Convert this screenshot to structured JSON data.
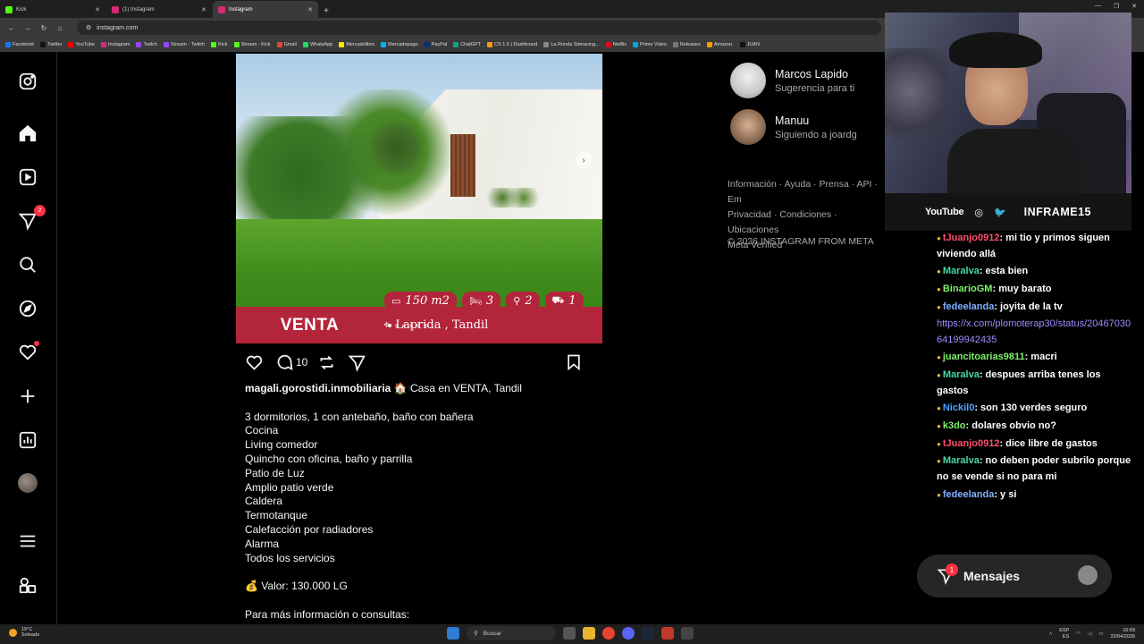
{
  "browser": {
    "tabs": [
      {
        "label": "Kick",
        "active": false,
        "color": "#53fc18"
      },
      {
        "label": "(1) Instagram",
        "active": false,
        "color": "#d62976"
      },
      {
        "label": "Instagram",
        "active": true,
        "color": "#d62976"
      }
    ],
    "url": "instagram.com",
    "bookmarks": [
      "Facebook",
      "Twitter",
      "YouTube",
      "Instagram",
      "Twitch",
      "Stream - Twitch",
      "Kick",
      "Stream - Kick",
      "Gmail",
      "WhatsApp",
      "Mercadolibre",
      "Mercadopago",
      "PayPal",
      "ChatGPT",
      "CS 1.6 | Dashboard",
      "La Ronda Simracing...",
      "Netflix",
      "Prime Video",
      "Releases",
      "Amazon.",
      "JUAN"
    ]
  },
  "sidebar": {
    "messages_badge": "2"
  },
  "post": {
    "banner_label": "VENTA",
    "location": "Laprida , Tandil",
    "features": {
      "area": "150 m2",
      "bedrooms": "3",
      "bathrooms": "2",
      "garage": "1"
    },
    "comment_count": "10",
    "username": "magali.gorostidi.inmobiliaria",
    "title": "🏠 Casa en VENTA, Tandil",
    "lines": [
      "3 dormitorios, 1 con antebaño, baño con bañera",
      "Cocina",
      "Living comedor",
      "Quincho con oficina, baño y parrilla",
      "Patio de Luz",
      "Amplio patio verde",
      "Caldera",
      "Termotanque",
      "Calefacción por radiadores",
      "Alarma",
      "Todos los servicios"
    ],
    "price": "💰 Valor: 130.000 LG",
    "more_info": "Para más información o consultas:"
  },
  "suggestions": [
    {
      "name": "Marcos Lapido",
      "sub": "Sugerencia para ti"
    },
    {
      "name": "Manuu",
      "sub": "Siguiendo a joardg"
    }
  ],
  "footer": {
    "links_line1": "Información · Ayuda · Prensa · API · Em",
    "links_line2": "Privacidad · Condiciones · Ubicaciones",
    "links_line3": "Meta Verified",
    "copyright": "© 2026 INSTAGRAM FROM META"
  },
  "stream": {
    "platform": "YouTube",
    "handle": "INFRAME15"
  },
  "chat": [
    {
      "user": "tJuanjo0912",
      "color": "#ff4f6d",
      "text": ": mi tio y primos siguen viviendo allá"
    },
    {
      "user": "Maralva",
      "color": "#43d9a8",
      "text": ": esta bien"
    },
    {
      "user": "BinarioGM",
      "color": "#7cf26a",
      "text": ": muy barato"
    },
    {
      "user": "fedeelanda",
      "color": "#7fb0ff",
      "text": ": joyita de la tv"
    },
    {
      "user": "",
      "color": "#9d8cff",
      "text": "https://x.com/plomoterap30/status/2046703064199942435"
    },
    {
      "user": "juancitoarias9811",
      "color": "#7cf26a",
      "text": ": macri"
    },
    {
      "user": "Maralva",
      "color": "#43d9a8",
      "text": ": despues arriba tenes los gastos"
    },
    {
      "user": "Nickil0",
      "color": "#4fa3ff",
      "text": ": son 130 verdes seguro"
    },
    {
      "user": "k3do",
      "color": "#7cf26a",
      "text": ": dolares obvio no?"
    },
    {
      "user": "tJuanjo0912",
      "color": "#ff4f6d",
      "text": ": dice libre de gastos"
    },
    {
      "user": "Maralva",
      "color": "#43d9a8",
      "text": ": no deben poder subrilo porque no se vende si no para mi"
    },
    {
      "user": "fedeelanda",
      "color": "#7fb0ff",
      "text": ": y si"
    }
  ],
  "messages_widget": {
    "label": "Mensajes",
    "badge": "1"
  },
  "taskbar": {
    "weather_temp": "19°C",
    "weather_desc": "Soleado",
    "search": "Buscar",
    "lang1": "ESP",
    "lang2": "ES",
    "time": "16:59",
    "date": "22/04/2026"
  }
}
